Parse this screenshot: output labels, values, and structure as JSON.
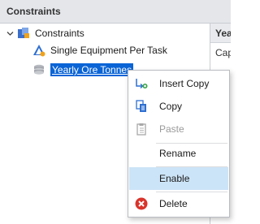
{
  "panel": {
    "title": "Constraints"
  },
  "right_pane": {
    "header": "Yea",
    "row_text": "Cap"
  },
  "tree": {
    "root": {
      "label": "Constraints",
      "icon": "constraints-folder-icon"
    },
    "children": [
      {
        "label": "Single Equipment Per Task",
        "icon": "equipment-constraint-icon",
        "selected": false
      },
      {
        "label": "Yearly Ore Tonnes",
        "icon": "tonnes-stack-icon",
        "selected": true
      }
    ]
  },
  "context_menu": {
    "items": [
      {
        "label": "Insert Copy",
        "icon": "insert-copy-icon",
        "enabled": true
      },
      {
        "label": "Copy",
        "icon": "copy-icon",
        "enabled": true
      },
      {
        "label": "Paste",
        "icon": "paste-icon",
        "enabled": false
      },
      {
        "label": "Rename",
        "icon": "",
        "enabled": true
      },
      {
        "label": "Enable",
        "icon": "",
        "enabled": true,
        "highlighted": true
      },
      {
        "label": "Delete",
        "icon": "delete-icon",
        "enabled": true
      }
    ]
  },
  "colors": {
    "selection": "#0a64d6",
    "menu_highlight": "#cce4f7",
    "delete_red": "#d9342b",
    "header_bg": "#e4e6ea"
  }
}
